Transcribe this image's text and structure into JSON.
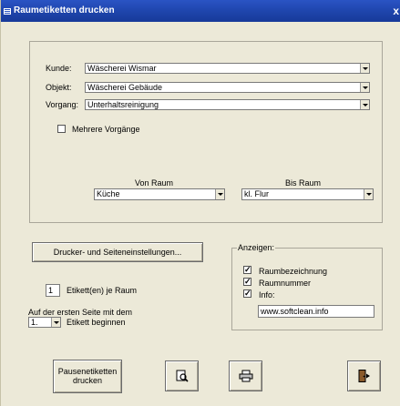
{
  "window": {
    "title": "Raumetiketten drucken",
    "close": "x"
  },
  "fields": {
    "kunde": {
      "label": "Kunde:",
      "value": "Wäscherei Wismar"
    },
    "objekt": {
      "label": "Objekt:",
      "value": "Wäscherei Gebäude"
    },
    "vorgang": {
      "label": "Vorgang:",
      "value": "Unterhaltsreinigung"
    },
    "mehrere": {
      "label": "Mehrere Vorgänge",
      "checked": false
    }
  },
  "range": {
    "von_label": "Von Raum",
    "von_value": "Küche",
    "bis_label": "Bis Raum",
    "bis_value": "kl. Flur"
  },
  "printer_button": "Drucker- und Seiteneinstellungen...",
  "etiketten": {
    "value": "1",
    "label": "Etikett(en) je Raum"
  },
  "start": {
    "line1": "Auf der ersten Seite mit dem",
    "value": "1.",
    "label": "Etikett beginnen"
  },
  "anzeigen": {
    "legend": "Anzeigen:",
    "items": [
      {
        "label": "Raumbezeichnung",
        "checked": true
      },
      {
        "label": "Raumnummer",
        "checked": true
      },
      {
        "label": "Info:",
        "checked": true
      }
    ],
    "info_value": "www.softclean.info"
  },
  "buttons": {
    "print_line1": "Pausenetiketten",
    "print_line2": "drucken",
    "preview_icon": "print-preview-icon",
    "printer_icon": "printer-icon",
    "exit_icon": "exit-door-icon"
  }
}
